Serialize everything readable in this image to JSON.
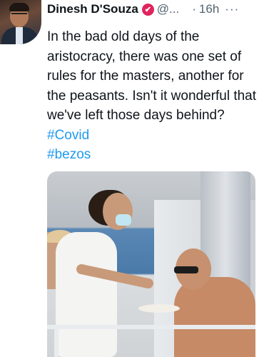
{
  "tweet": {
    "author_name": "Dinesh D'Souza",
    "verified_badge": "✔",
    "handle": "@...",
    "separator": "·",
    "time": "16h",
    "more": "···",
    "text": "In the bad old days of the aristocracy, there was one set of rules for the masters, another for the peasants. Isn't it wonderful that we've left those days behind?",
    "hashtags": [
      "#Covid",
      "#bezos"
    ]
  },
  "icons": {
    "verified": "verified-badge-icon",
    "more": "more-options-icon"
  },
  "colors": {
    "hashtag": "#1d9bf0",
    "secondary_text": "#536471",
    "verified_badge": "#e0245e"
  }
}
